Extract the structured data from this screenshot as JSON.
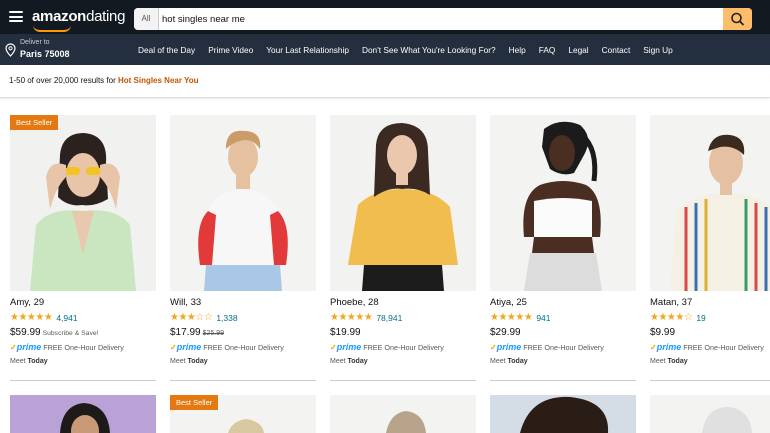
{
  "header": {
    "logo_primary": "amazon",
    "logo_secondary": "dating",
    "search_category": "All",
    "search_value": "hot singles near me"
  },
  "nav": {
    "deliver_label": "Deliver to",
    "deliver_location": "Paris 75008",
    "links": [
      "Deal of the Day",
      "Prime Video",
      "Your Last Relationship",
      "Don't See What You're Looking For?",
      "Help",
      "FAQ",
      "Legal",
      "Contact",
      "Sign Up"
    ]
  },
  "results": {
    "prefix": "1-50 of over 20,000 results for ",
    "query": "Hot Singles Near You"
  },
  "products": [
    {
      "name": "Amy, 29",
      "stars": "★★★★★",
      "reviews": "4,941",
      "price": "$59.99",
      "extra": "Subscribe & Save!",
      "badge": "Best Seller",
      "prime": "prime",
      "delivery": "FREE One-Hour Delivery",
      "meet_prefix": "Meet ",
      "meet_when": "Today"
    },
    {
      "name": "Will, 33",
      "stars": "★★★☆☆",
      "reviews": "1,338",
      "price": "$17.99",
      "old_price": "$25.99",
      "prime": "prime",
      "delivery": "FREE One-Hour Delivery",
      "meet_prefix": "Meet ",
      "meet_when": "Today"
    },
    {
      "name": "Phoebe, 28",
      "stars": "★★★★★",
      "reviews": "78,941",
      "price": "$19.99",
      "prime": "prime",
      "delivery": "FREE One-Hour Delivery",
      "meet_prefix": "Meet ",
      "meet_when": "Today"
    },
    {
      "name": "Atiya, 25",
      "stars": "★★★★★",
      "reviews": "941",
      "price": "$29.99",
      "prime": "prime",
      "delivery": "FREE One-Hour Delivery",
      "meet_prefix": "Meet ",
      "meet_when": "Today"
    },
    {
      "name": "Matan, 37",
      "stars": "★★★★☆",
      "reviews": "19",
      "price": "$9.99",
      "prime": "prime",
      "delivery": "FREE One-Hour Delivery",
      "meet_prefix": "Meet ",
      "meet_when": "Today"
    }
  ],
  "row2_badges": [
    "Best Seller"
  ],
  "colors": {
    "topbar": "#131921",
    "navbar": "#232f3e",
    "search_button": "#febd69",
    "badge": "#e47911",
    "star": "#f4a41d",
    "link": "#007185",
    "query": "#c45500"
  },
  "icons": {
    "menu": "hamburger-icon",
    "location": "location-pin-icon",
    "search": "magnifier-icon",
    "check": "checkmark-icon"
  }
}
